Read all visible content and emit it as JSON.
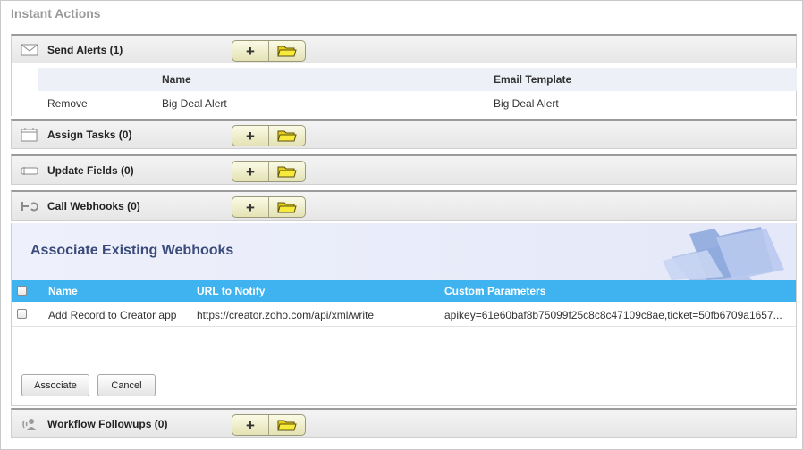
{
  "page_title": "Instant Actions",
  "sections": [
    {
      "id": "send-alerts",
      "label": "Send Alerts (1)",
      "icon": "envelope-icon"
    },
    {
      "id": "assign-tasks",
      "label": "Assign Tasks (0)",
      "icon": "calendar-icon"
    },
    {
      "id": "update-fields",
      "label": "Update Fields (0)",
      "icon": "field-icon"
    },
    {
      "id": "call-webhooks",
      "label": "Call Webhooks (0)",
      "icon": "webhook-icon"
    },
    {
      "id": "workflow-followups",
      "label": "Workflow Followups (0)",
      "icon": "speaker-icon"
    }
  ],
  "alerts_table": {
    "headers": {
      "name": "Name",
      "email_template": "Email Template"
    },
    "rows": [
      {
        "action": "Remove",
        "name": "Big Deal Alert",
        "email_template": "Big Deal Alert"
      }
    ]
  },
  "webhooks": {
    "title": "Associate Existing Webhooks",
    "headers": {
      "name": "Name",
      "url": "URL to Notify",
      "params": "Custom Parameters"
    },
    "rows": [
      {
        "name": "Add Record to Creator app",
        "url": "https://creator.zoho.com/api/xml/write",
        "params": "apikey=61e60baf8b75099f25c8c8c47109c8ae,ticket=50fb6709a1657..."
      }
    ],
    "associate_label": "Associate",
    "cancel_label": "Cancel"
  },
  "colors": {
    "accent_header": "#3fb3f0",
    "button_yellow": "#e4e2b4",
    "folder_yellow": "#f2e21c",
    "title_blue": "#3a4a7a"
  }
}
